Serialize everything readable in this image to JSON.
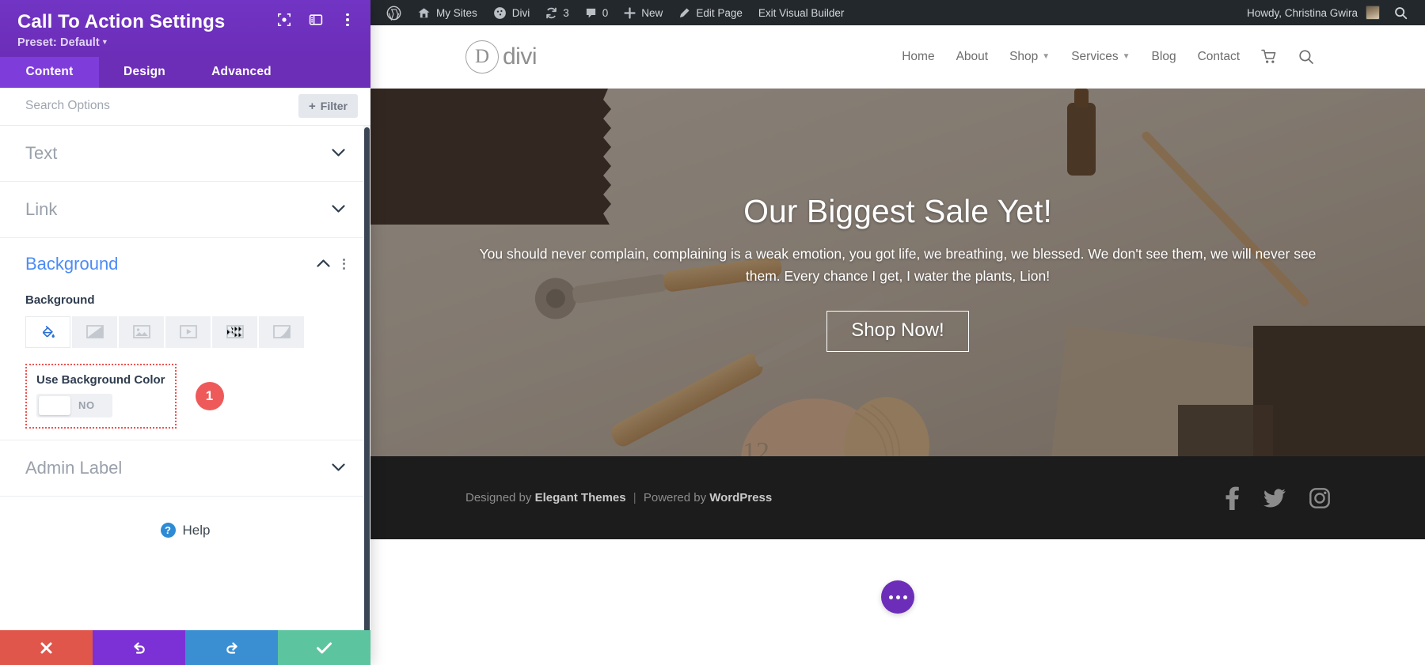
{
  "settings_panel": {
    "title": "Call To Action Settings",
    "preset_label": "Preset: Default",
    "header_icons": [
      {
        "name": "focus-target-icon"
      },
      {
        "name": "panel-layout-icon"
      },
      {
        "name": "more-options-icon"
      }
    ],
    "tabs": [
      {
        "label": "Content",
        "active": true
      },
      {
        "label": "Design",
        "active": false
      },
      {
        "label": "Advanced",
        "active": false
      }
    ],
    "search_placeholder": "Search Options",
    "filter_label": "Filter",
    "sections": [
      {
        "label": "Text",
        "open": false
      },
      {
        "label": "Link",
        "open": false
      },
      {
        "label": "Background",
        "open": true
      },
      {
        "label": "Admin Label",
        "open": false
      }
    ],
    "background": {
      "group_label": "Background",
      "field_label": "Background",
      "types": [
        {
          "name": "background-color-icon",
          "active": true
        },
        {
          "name": "background-gradient-icon",
          "active": false
        },
        {
          "name": "background-image-icon",
          "active": false
        },
        {
          "name": "background-video-icon",
          "active": false
        },
        {
          "name": "background-pattern-icon",
          "active": false
        },
        {
          "name": "background-mask-icon",
          "active": false
        }
      ],
      "toggle": {
        "label": "Use Background Color",
        "state": "NO",
        "highlighted": true
      },
      "step_badge": "1"
    },
    "help_label": "Help",
    "footer_actions": [
      {
        "name": "cancel-changes-button",
        "icon": "close-icon",
        "color": "#e0564b"
      },
      {
        "name": "undo-button",
        "icon": "undo-icon",
        "color": "#7c31d6"
      },
      {
        "name": "redo-button",
        "icon": "redo-icon",
        "color": "#3a8fd3"
      },
      {
        "name": "save-changes-button",
        "icon": "check-icon",
        "color": "#5cc5a0"
      }
    ],
    "colors": {
      "header_purple": "#6c2eb9",
      "tab_active": "#7e3ddb",
      "accent_blue": "#4c8bf5",
      "badge_red": "#ee5a5a"
    }
  },
  "admin_bar": {
    "items": [
      {
        "label": "",
        "icon": "wordpress-logo-icon"
      },
      {
        "label": "My Sites",
        "icon": "sites-icon"
      },
      {
        "label": "Divi",
        "icon": "divi-icon"
      },
      {
        "label": "3",
        "icon": "updates-icon"
      },
      {
        "label": "0",
        "icon": "comments-icon"
      },
      {
        "label": "New",
        "icon": "plus-icon"
      },
      {
        "label": "Edit Page",
        "icon": "pencil-icon"
      },
      {
        "label": "Exit Visual Builder",
        "icon": ""
      }
    ],
    "greeting": "Howdy, Christina Gwira",
    "avatar": "user-avatar",
    "search_icon": "search-icon"
  },
  "site": {
    "logo_letter": "D",
    "logo_word": "divi",
    "nav": [
      {
        "label": "Home",
        "has_dropdown": false
      },
      {
        "label": "About",
        "has_dropdown": false
      },
      {
        "label": "Shop",
        "has_dropdown": true
      },
      {
        "label": "Services",
        "has_dropdown": true
      },
      {
        "label": "Blog",
        "has_dropdown": false
      },
      {
        "label": "Contact",
        "has_dropdown": false
      }
    ],
    "nav_icons": [
      {
        "name": "cart-icon"
      },
      {
        "name": "search-icon"
      }
    ],
    "hero": {
      "title": "Our Biggest Sale Yet!",
      "subtitle": "You should never complain, complaining is a weak emotion, you got life, we breathing, we blessed. We don't see them, we will never see them. Every chance I get, I water the plants, Lion!",
      "button_label": "Shop Now!"
    },
    "footer": {
      "designed_prefix": "Designed by",
      "designed_by": "Elegant Themes",
      "separator": "|",
      "powered_prefix": "Powered by",
      "powered_by": "WordPress",
      "social": [
        {
          "name": "facebook-icon"
        },
        {
          "name": "twitter-icon"
        },
        {
          "name": "instagram-icon"
        }
      ]
    },
    "fab": {
      "name": "page-settings-fab",
      "icon": "ellipsis-icon"
    }
  }
}
